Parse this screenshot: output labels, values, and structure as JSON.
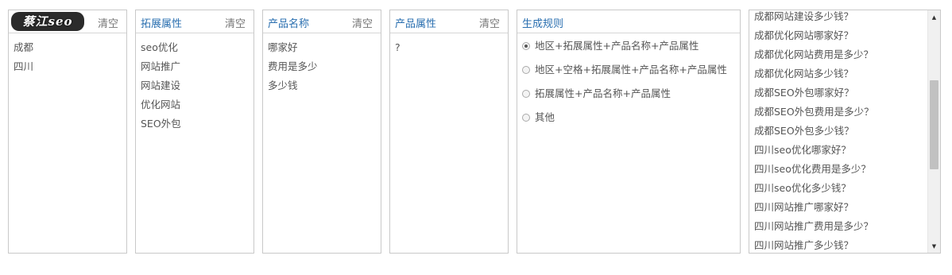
{
  "logo": {
    "text": "蔡江seo"
  },
  "panels": {
    "region": {
      "title": "",
      "clear": "清空",
      "items": [
        "成都",
        "四川"
      ]
    },
    "extended": {
      "title": "拓展属性",
      "clear": "清空",
      "items": [
        "seo优化",
        "网站推广",
        "网站建设",
        "优化网站",
        "SEO外包"
      ]
    },
    "product_name": {
      "title": "产品名称",
      "clear": "清空",
      "items": [
        "哪家好",
        "费用是多少",
        "多少钱"
      ]
    },
    "product_attr": {
      "title": "产品属性",
      "clear": "清空",
      "items": [
        "?"
      ]
    }
  },
  "rules": {
    "title": "生成规则",
    "options": [
      {
        "label": "地区+拓展属性+产品名称+产品属性",
        "selected": true
      },
      {
        "label": "地区+空格+拓展属性+产品名称+产品属性",
        "selected": false
      },
      {
        "label": "拓展属性+产品名称+产品属性",
        "selected": false
      },
      {
        "label": "其他",
        "selected": false
      }
    ]
  },
  "output": {
    "lines": [
      "成都网站建设多少钱？",
      "成都优化网站哪家好？",
      "成都优化网站费用是多少？",
      "成都优化网站多少钱？",
      "成都SEO外包哪家好？",
      "成都SEO外包费用是多少？",
      "成都SEO外包多少钱？",
      "四川seo优化哪家好？",
      "四川seo优化费用是多少？",
      "四川seo优化多少钱？",
      "四川网站推广哪家好？",
      "四川网站推广费用是多少？",
      "四川网站推广多少钱？"
    ],
    "scroll_up": "▲",
    "scroll_down": "▼"
  }
}
